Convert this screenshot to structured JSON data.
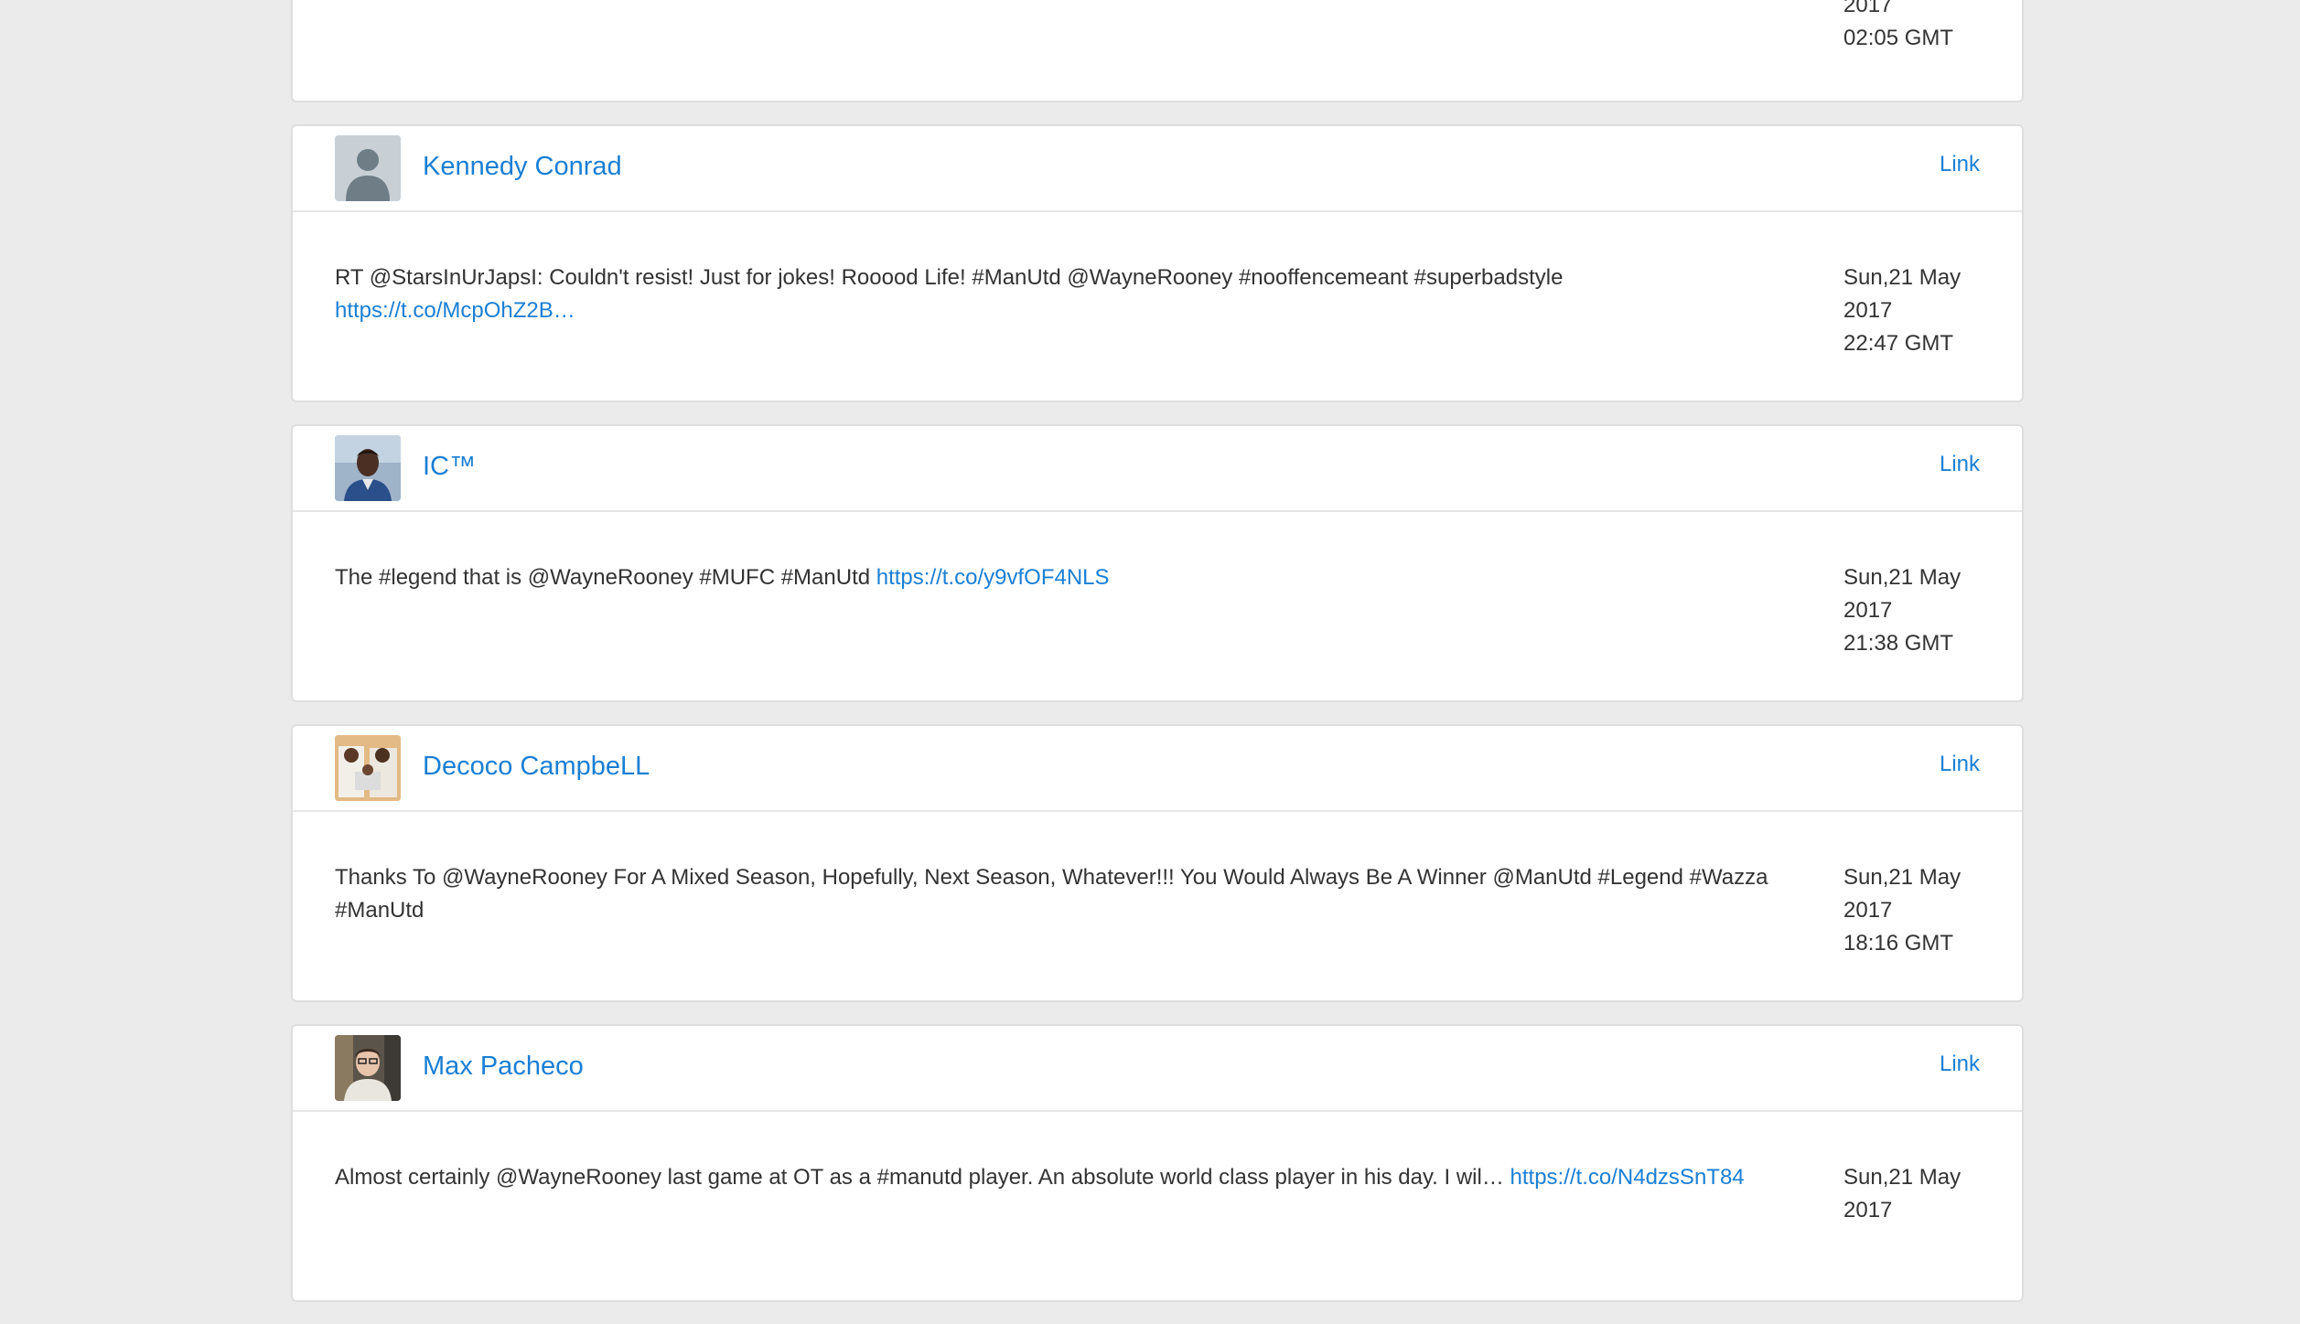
{
  "partial_card": {
    "date_year": "2017",
    "date_time": "02:05 GMT"
  },
  "tweets": [
    {
      "name": "Kennedy Conrad",
      "link_label": "Link",
      "text": "RT @StarsInUrJapsI: Couldn't resist! Just for jokes! Rooood Life! #ManUtd @WayneRooney #nooffencemeant #superbadstyle ",
      "url": "https://t.co/McpOhZ2B…",
      "date_day": "Sun,21 May",
      "date_year": "2017",
      "date_time": "22:47 GMT",
      "avatar": "default-avatar-icon"
    },
    {
      "name": "IC™",
      "link_label": "Link",
      "text": "The #legend that is @WayneRooney #MUFC #ManUtd ",
      "url": "https://t.co/y9vfOF4NLS",
      "date_day": "Sun,21 May",
      "date_year": "2017",
      "date_time": "21:38 GMT",
      "avatar": "profile-photo"
    },
    {
      "name": "Decoco CampbeLL",
      "link_label": "Link",
      "text": "Thanks To @WayneRooney For A Mixed Season, Hopefully, Next Season, Whatever!!! You Would Always Be A Winner @ManUtd #Legend #Wazza #ManUtd",
      "url": "",
      "date_day": "Sun,21 May",
      "date_year": "2017",
      "date_time": "18:16 GMT",
      "avatar": "profile-photo"
    },
    {
      "name": "Max Pacheco",
      "link_label": "Link",
      "text": "Almost certainly @WayneRooney last game at OT as a #manutd player. An absolute world class player in his day. I wil… ",
      "url": "https://t.co/N4dzsSnT84",
      "date_day": "Sun,21 May",
      "date_year": "2017",
      "date_time": "",
      "avatar": "profile-photo"
    }
  ],
  "colors": {
    "link": "#1a7fd4",
    "background": "#ebebeb",
    "card": "#ffffff",
    "text": "#333333"
  }
}
